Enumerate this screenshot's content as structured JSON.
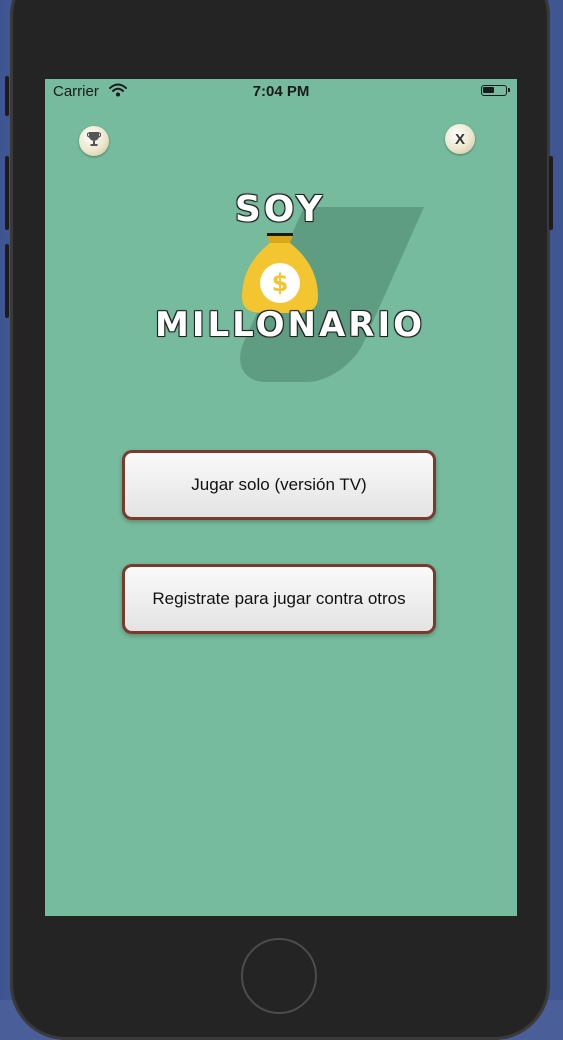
{
  "status_bar": {
    "carrier": "Carrier",
    "time": "7:04 PM",
    "battery_level": 0.55
  },
  "top_bar": {
    "left_icon": "trophy-icon",
    "close_label": "X"
  },
  "logo": {
    "line1": "SOY",
    "line2": "MILLONARIO",
    "bag_symbol": "$"
  },
  "menu": {
    "solo_label": "Jugar solo (versión TV)",
    "register_label": "Registrate para jugar contra otros"
  },
  "colors": {
    "screen_background": "#76bb9d",
    "button_border": "#7a3a2e",
    "bag_gold": "#f2c531"
  }
}
